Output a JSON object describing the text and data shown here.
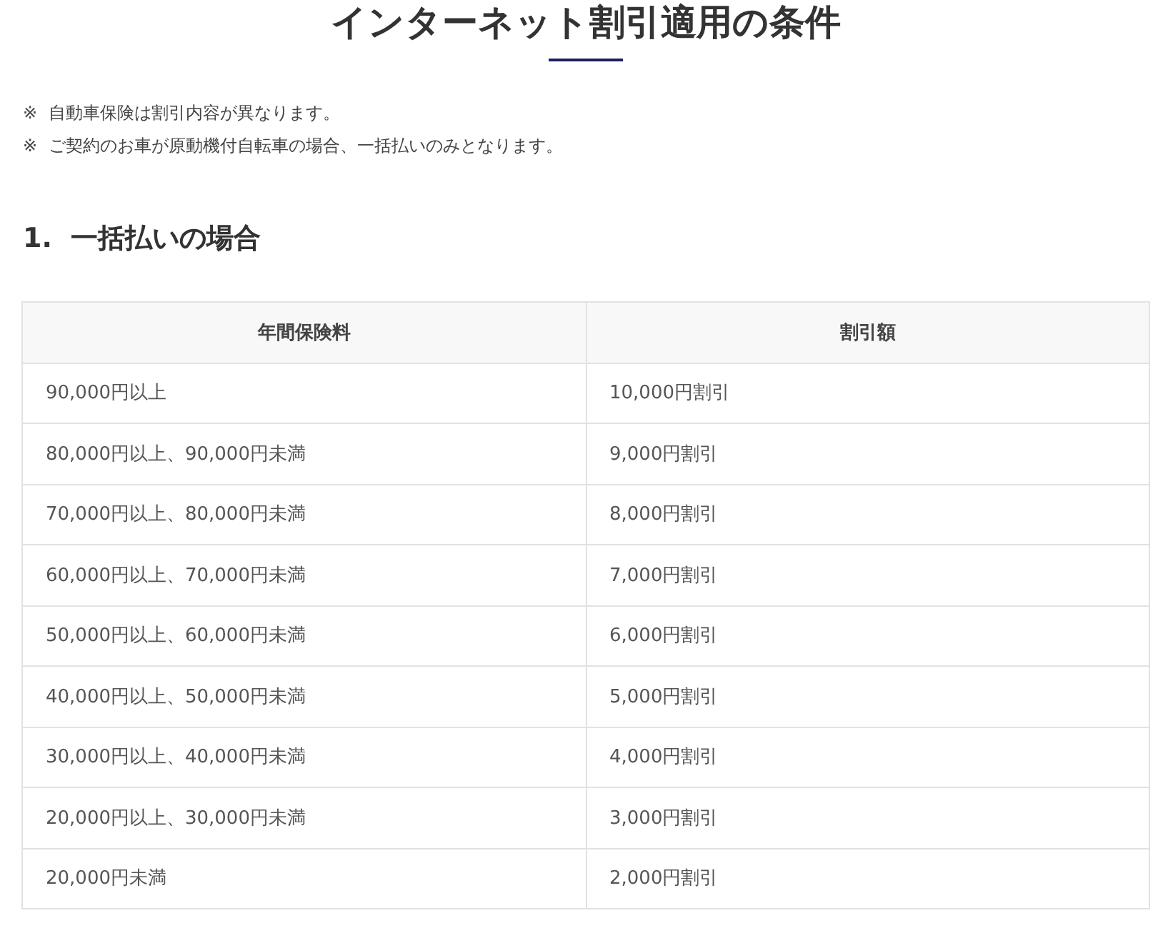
{
  "title": "インターネット割引適用の条件",
  "notes": [
    {
      "mark": "※",
      "text": "自動車保険は割引内容が異なります。"
    },
    {
      "mark": "※",
      "text": "ご契約のお車が原動機付自転車の場合、一括払いのみとなります。"
    }
  ],
  "section_heading": "1.  一括払いの場合",
  "table": {
    "columns": [
      "年間保険料",
      "割引額"
    ],
    "rows": [
      [
        "90,000円以上",
        "10,000円割引"
      ],
      [
        "80,000円以上、90,000円未満",
        "9,000円割引"
      ],
      [
        "70,000円以上、80,000円未満",
        "8,000円割引"
      ],
      [
        "60,000円以上、70,000円未満",
        "7,000円割引"
      ],
      [
        "50,000円以上、60,000円未満",
        "6,000円割引"
      ],
      [
        "40,000円以上、50,000円未満",
        "5,000円割引"
      ],
      [
        "30,000円以上、40,000円未満",
        "4,000円割引"
      ],
      [
        "20,000円以上、30,000円未満",
        "3,000円割引"
      ],
      [
        "20,000円未満",
        "2,000円割引"
      ]
    ]
  }
}
